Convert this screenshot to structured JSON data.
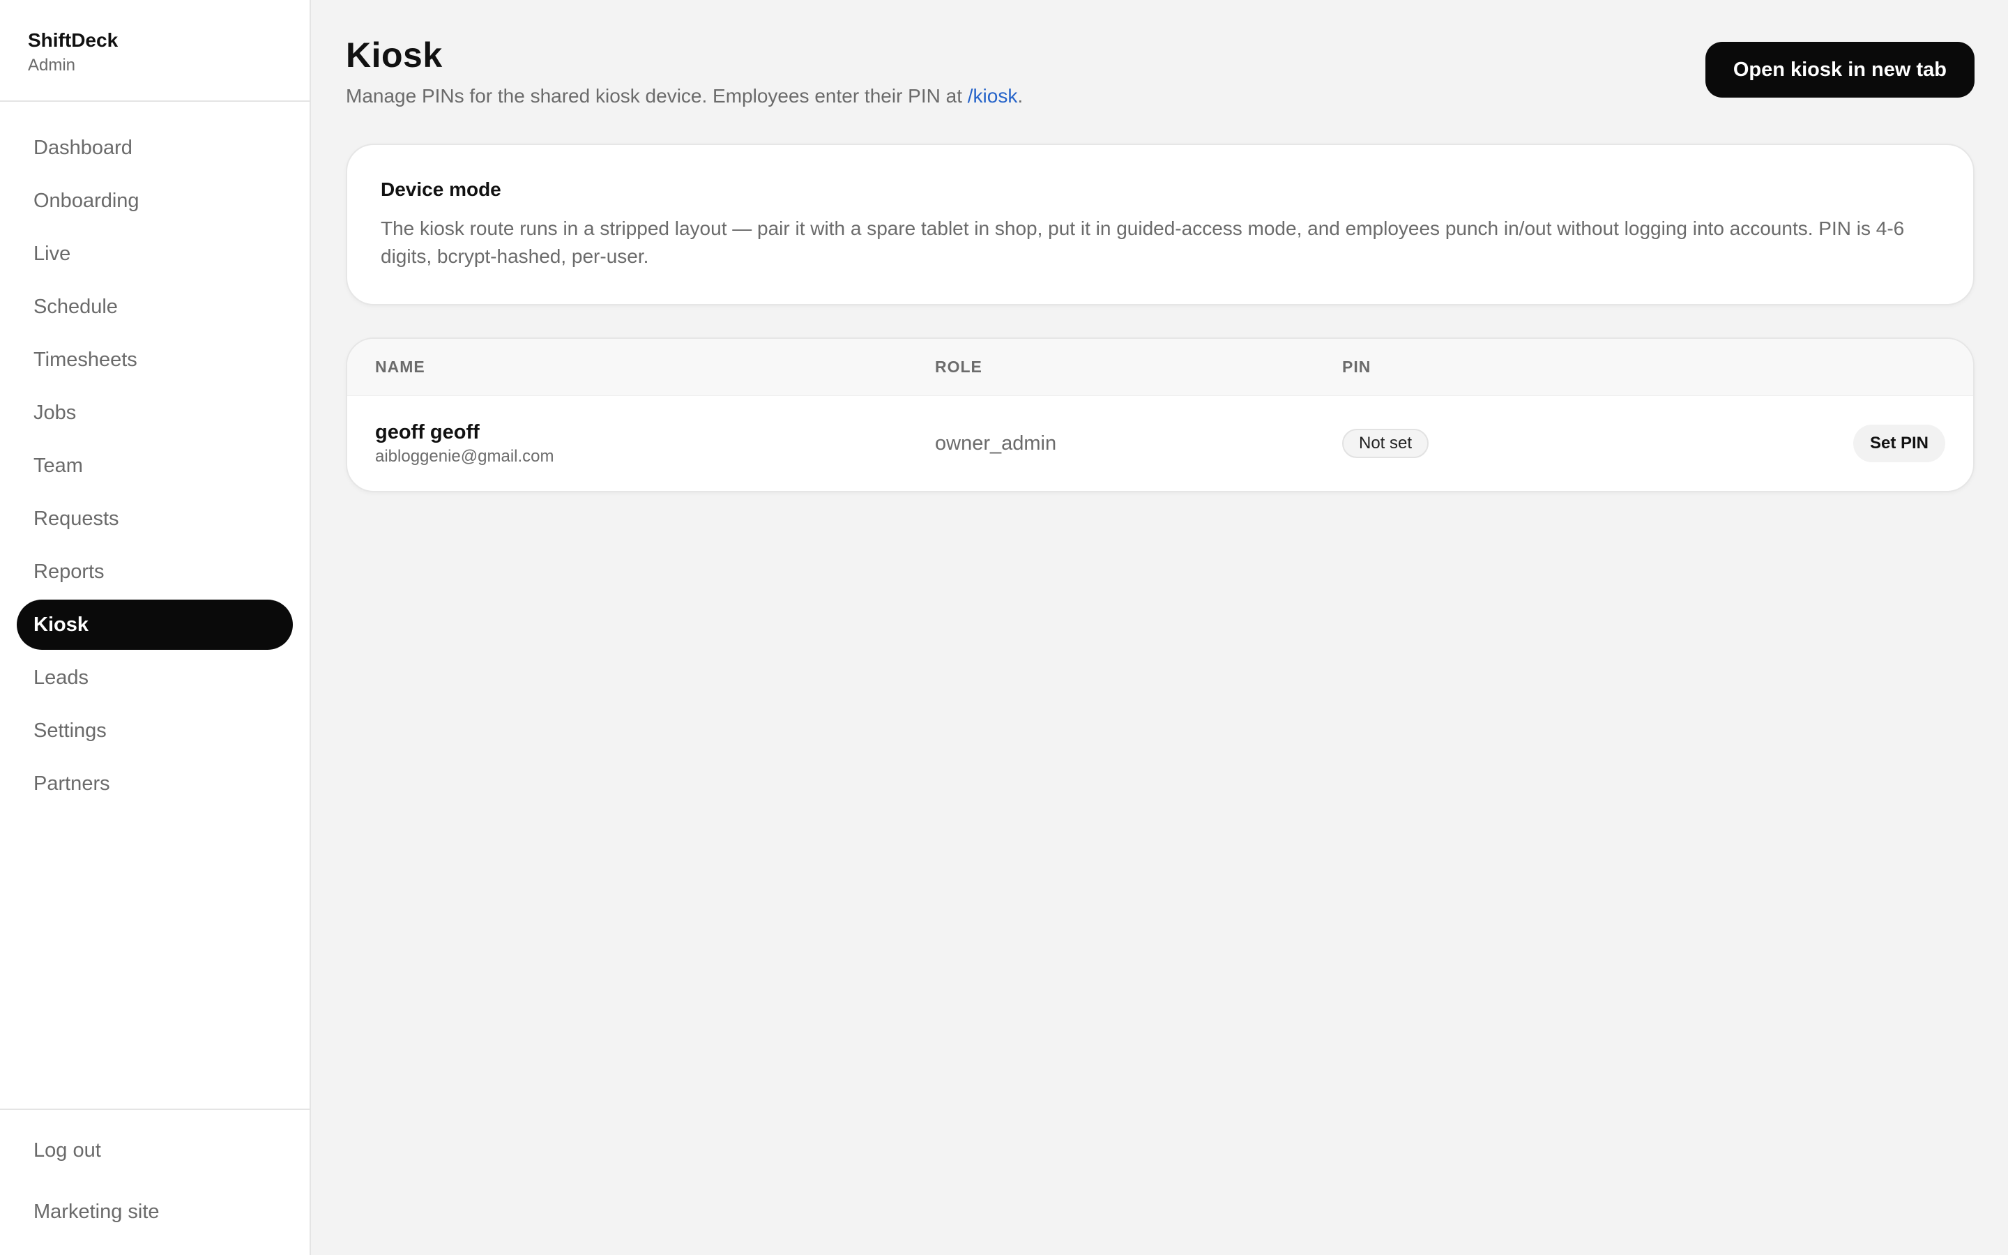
{
  "brand": {
    "name": "ShiftDeck",
    "role": "Admin"
  },
  "nav": {
    "items": [
      {
        "key": "dashboard",
        "label": "Dashboard"
      },
      {
        "key": "onboarding",
        "label": "Onboarding"
      },
      {
        "key": "live",
        "label": "Live"
      },
      {
        "key": "schedule",
        "label": "Schedule"
      },
      {
        "key": "timesheets",
        "label": "Timesheets"
      },
      {
        "key": "jobs",
        "label": "Jobs"
      },
      {
        "key": "team",
        "label": "Team"
      },
      {
        "key": "requests",
        "label": "Requests"
      },
      {
        "key": "reports",
        "label": "Reports"
      },
      {
        "key": "kiosk",
        "label": "Kiosk",
        "active": true
      },
      {
        "key": "leads",
        "label": "Leads"
      },
      {
        "key": "settings",
        "label": "Settings"
      },
      {
        "key": "partners",
        "label": "Partners"
      }
    ],
    "footer": {
      "logout": "Log out",
      "marketing": "Marketing site"
    }
  },
  "page": {
    "title": "Kiosk",
    "subtitle_prefix": "Manage PINs for the shared kiosk device. Employees enter their PIN at ",
    "subtitle_link": "/kiosk",
    "subtitle_suffix": ".",
    "open_button": "Open kiosk in new tab"
  },
  "device_card": {
    "title": "Device mode",
    "text": "The kiosk route runs in a stripped layout — pair it with a spare tablet in shop, put it in guided-access mode, and employees punch in/out without logging into accounts. PIN is 4-6 digits, bcrypt-hashed, per-user."
  },
  "table": {
    "headers": {
      "name": "NAME",
      "role": "ROLE",
      "pin": "PIN"
    },
    "rows": [
      {
        "name": "geoff geoff",
        "email": "aibloggenie@gmail.com",
        "role": "owner_admin",
        "pin_status": "Not set",
        "action": "Set PIN"
      }
    ]
  },
  "colors": {
    "accent": "#0a0a0a",
    "link": "#2563c9",
    "background": "#f3f3f3"
  }
}
